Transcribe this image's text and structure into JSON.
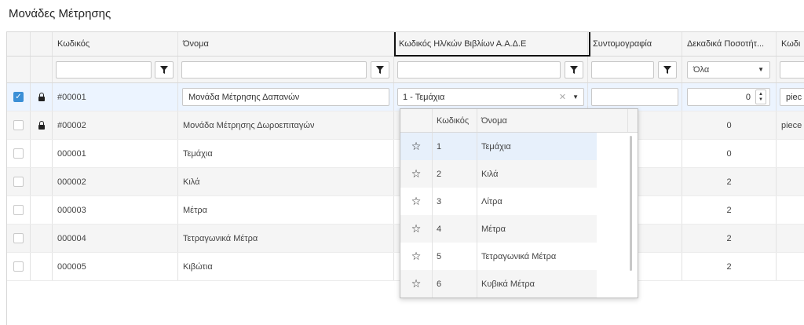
{
  "page": {
    "title": "Μονάδες Μέτρησης"
  },
  "columns": {
    "code": "Κωδικός",
    "name": "Όνομα",
    "aade_code": "Κωδικός Ηλ/κών Βιβλίων Α.Α.Δ.Ε",
    "abbreviation": "Συντομογραφία",
    "decimals": "Δεκαδικά Ποσοτήτ...",
    "code2": "Κωδι"
  },
  "filters": {
    "decimals_select": "Όλα"
  },
  "rows": [
    {
      "code": "#00001",
      "name": "Μονάδα Μέτρησης Δαπανών",
      "aade": "1 - Τεμάχια",
      "abbr": "",
      "decimals": "0",
      "code2": "piec",
      "locked": true,
      "checked": true
    },
    {
      "code": "#00002",
      "name": "Μονάδα Μέτρησης Δωροεπιταγών",
      "decimals": "0",
      "code2": "piece",
      "locked": true,
      "checked": false
    },
    {
      "code": "000001",
      "name": "Τεμάχια",
      "decimals": "0",
      "checked": false
    },
    {
      "code": "000002",
      "name": "Κιλά",
      "decimals": "2",
      "checked": false
    },
    {
      "code": "000003",
      "name": "Μέτρα",
      "decimals": "2",
      "checked": false
    },
    {
      "code": "000004",
      "name": "Τετραγωνικά Μέτρα",
      "decimals": "2",
      "checked": false
    },
    {
      "code": "000005",
      "name": "Κιβώτια",
      "decimals": "2",
      "checked": false
    }
  ],
  "dropdown": {
    "headers": {
      "code": "Κωδικός",
      "name": "Όνομα"
    },
    "items": [
      {
        "code": "1",
        "name": "Τεμάχια"
      },
      {
        "code": "2",
        "name": "Κιλά"
      },
      {
        "code": "3",
        "name": "Λίτρα"
      },
      {
        "code": "4",
        "name": "Μέτρα"
      },
      {
        "code": "5",
        "name": "Τετραγωνικά Μέτρα"
      },
      {
        "code": "6",
        "name": "Κυβικά Μέτρα"
      }
    ]
  },
  "icons": {
    "filter": "filter-icon",
    "lock": "lock-icon",
    "star": "star-outline-icon",
    "check": "checkmark-icon",
    "clear": "clear-icon",
    "caret": "caret-down-icon",
    "spinner": "spinner-arrows-icon"
  },
  "colors": {
    "accent": "#3b8fd6",
    "selected_row": "#ecf4ff",
    "header_bg": "#f5f5f5"
  }
}
